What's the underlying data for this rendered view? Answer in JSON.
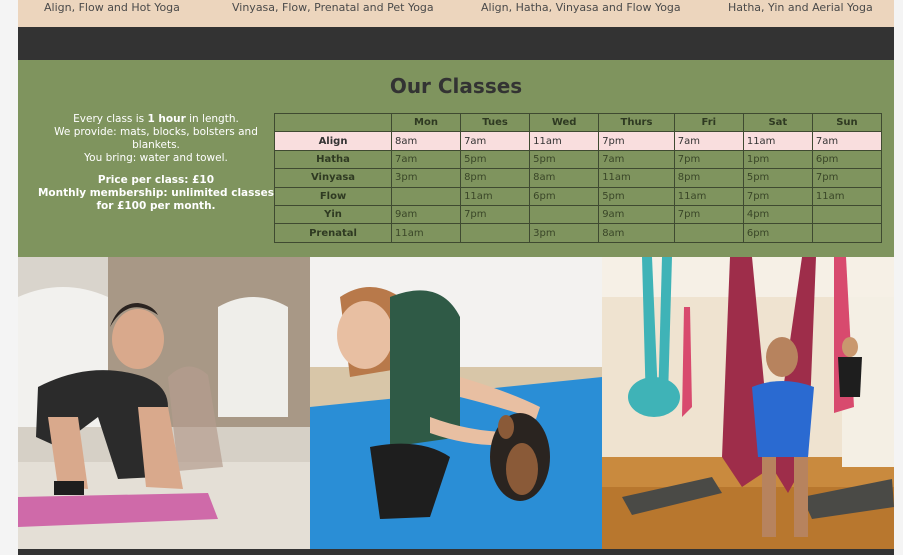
{
  "top_band": {
    "labels": [
      "Align, Flow and Hot Yoga",
      "Vinyasa, Flow, Prenatal and Pet Yoga",
      "Align, Hatha, Vinyasa and Flow Yoga",
      "Hatha, Yin and Aerial Yoga"
    ]
  },
  "classes": {
    "title": "Our Classes",
    "info": {
      "line1_pre": "Every class is ",
      "line1_bold": "1 hour",
      "line1_post": " in length.",
      "line2": "We provide: mats, blocks, bolsters and blankets.",
      "line3": "You bring: water and towel.",
      "price": "Price per class: £10",
      "membership": "Monthly membership: unlimited classes for £100 per month."
    },
    "days": [
      "Mon",
      "Tues",
      "Wed",
      "Thurs",
      "Fri",
      "Sat",
      "Sun"
    ],
    "rows": [
      {
        "name": "Align",
        "times": [
          "8am",
          "7am",
          "11am",
          "7pm",
          "7am",
          "11am",
          "7am"
        ]
      },
      {
        "name": "Hatha",
        "times": [
          "7am",
          "5pm",
          "5pm",
          "7am",
          "7pm",
          "1pm",
          "6pm"
        ]
      },
      {
        "name": "Vinyasa",
        "times": [
          "3pm",
          "8pm",
          "8am",
          "11am",
          "8pm",
          "5pm",
          "7pm"
        ]
      },
      {
        "name": "Flow",
        "times": [
          "",
          "11am",
          "6pm",
          "5pm",
          "11am",
          "7pm",
          "11am"
        ]
      },
      {
        "name": "Yin",
        "times": [
          "9am",
          "7pm",
          "",
          "9am",
          "7pm",
          "4pm",
          ""
        ]
      },
      {
        "name": "Prenatal",
        "times": [
          "11am",
          "",
          "3pm",
          "8am",
          "",
          "6pm",
          ""
        ]
      }
    ]
  },
  "colors": {
    "classes_bg": "#7f945e",
    "header_band": "#ecd5bd",
    "dark_bar": "#333333",
    "highlight_row": "#f9dede"
  }
}
